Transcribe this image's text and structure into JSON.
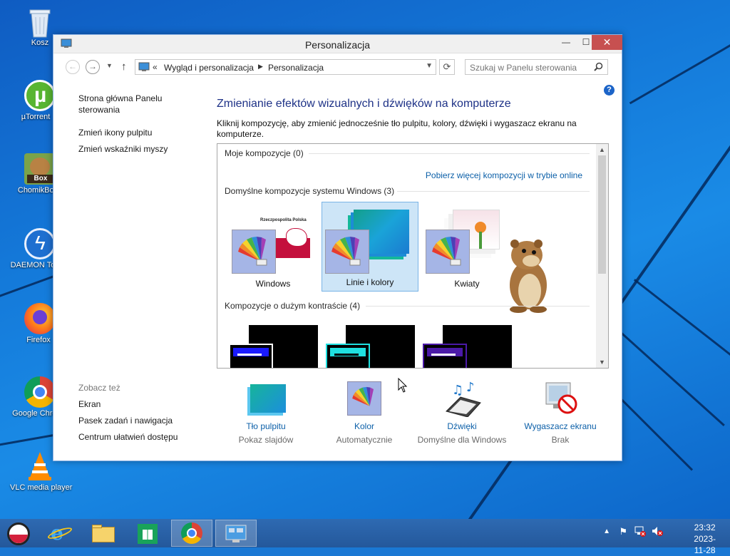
{
  "desktop": {
    "icons": [
      {
        "label": "Kosz",
        "icon": "recycle-bin-icon"
      },
      {
        "label": "µTorrent",
        "icon": "utorrent-icon"
      },
      {
        "label": "ChomikBox",
        "icon": "chomikbox-icon"
      },
      {
        "label": "DAEMON Tools",
        "icon": "daemon-tools-icon"
      },
      {
        "label": "Firefox",
        "icon": "firefox-icon"
      },
      {
        "label": "Google Chrome",
        "icon": "chrome-icon"
      },
      {
        "label": "VLC media player",
        "icon": "vlc-icon"
      }
    ]
  },
  "window": {
    "title": "Personalizacja",
    "address": {
      "chevron": "«",
      "crumb1": "Wygląd i personalizacja",
      "crumb2": "Personalizacja"
    },
    "search_placeholder": "Szukaj w Panelu sterowania",
    "help": "?"
  },
  "left_nav": {
    "home": "Strona główna Panelu sterowania",
    "links": [
      "Zmień ikony pulpitu",
      "Zmień wskaźniki myszy"
    ],
    "see_also_title": "Zobacz też",
    "see_also": [
      "Ekran",
      "Pasek zadań i nawigacja",
      "Centrum ułatwień dostępu"
    ]
  },
  "main": {
    "heading": "Zmienianie efektów wizualnych i dźwięków na komputerze",
    "instructions": "Kliknij kompozycję, aby zmienić jednocześnie tło pulpitu, kolory, dźwięki i wygaszacz ekranu na komputerze.",
    "groups": {
      "my": "Moje kompozycje (0)",
      "online_link": "Pobierz więcej kompozycji w trybie online",
      "default": "Domyślne kompozycje systemu Windows (3)",
      "high_contrast": "Kompozycje o dużym kontraście (4)"
    },
    "themes": [
      {
        "name": "Windows",
        "selected": false,
        "caption": "Rzeczpospolita Polska"
      },
      {
        "name": "Linie i kolory",
        "selected": true
      },
      {
        "name": "Kwiaty",
        "selected": false
      }
    ],
    "hc_colors": [
      "#1a1aff",
      "#1fe0e0",
      "#4b1aa8"
    ]
  },
  "bottom": [
    {
      "label": "Tło pulpitu",
      "value": "Pokaz slajdów",
      "icon": "desktop-background-icon"
    },
    {
      "label": "Kolor",
      "value": "Automatycznie",
      "icon": "color-palette-icon"
    },
    {
      "label": "Dźwięki",
      "value": "Domyślne dla Windows",
      "icon": "sounds-icon"
    },
    {
      "label": "Wygaszacz ekranu",
      "value": "Brak",
      "icon": "screensaver-icon"
    }
  ],
  "taskbar": {
    "time": "23:32",
    "date": "2023-11-28",
    "pinned": [
      "start-button",
      "internet-explorer-icon",
      "file-explorer-icon",
      "store-icon",
      "chrome-icon",
      "control-panel-icon"
    ]
  }
}
